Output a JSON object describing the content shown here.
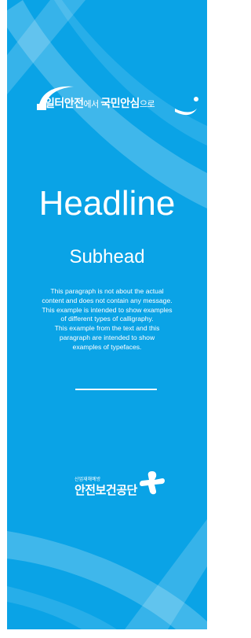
{
  "slogan": {
    "part1": "일터안전",
    "part2": "에서 ",
    "part3": "국민안심",
    "part4": "으로"
  },
  "headline": "Headline",
  "subhead": "Subhead",
  "paragraph_lines": [
    "This paragraph is not about the actual",
    "content and does not contain any message.",
    "This example is intended to show examples",
    "of different types of calligraphy.",
    "This example from the text and this",
    "paragraph are intended to show",
    "examples of typefaces."
  ],
  "logo": {
    "small_text": "산업재해예방",
    "name": "안전보건공단"
  },
  "colors": {
    "background": "#0aa3e6",
    "text": "#ffffff"
  }
}
